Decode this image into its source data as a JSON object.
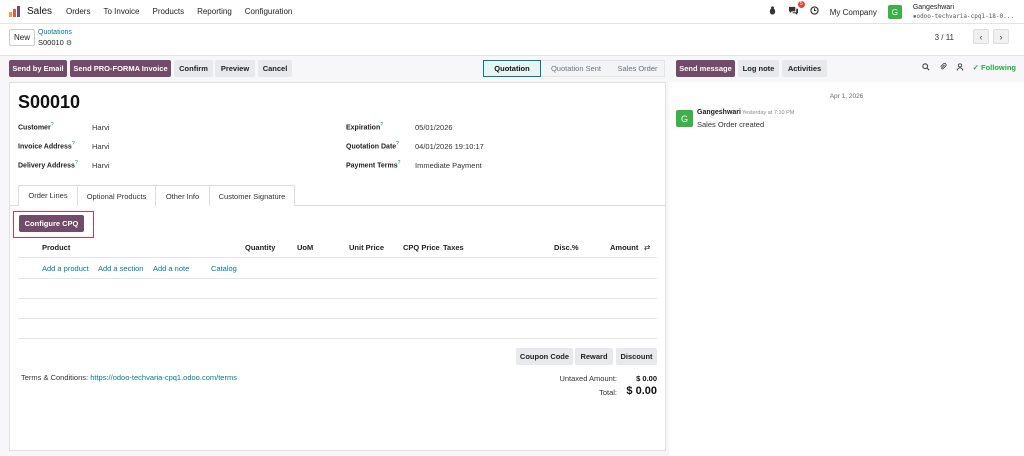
{
  "topnav": {
    "brand": "Sales",
    "menu": [
      "Orders",
      "To Invoice",
      "Products",
      "Reporting",
      "Configuration"
    ],
    "messages_badge": "5",
    "company": "My Company",
    "user_initial": "G",
    "user_name": "Gangeshwari",
    "user_db": "odoo-techvaria-cpq1-18-0..."
  },
  "control": {
    "new_label": "New",
    "breadcrumb_parent": "Quotations",
    "breadcrumb_current": "S00010",
    "pager": "3 / 11",
    "prev": "‹",
    "next": "›"
  },
  "actions": {
    "send_email": "Send by Email",
    "send_proforma": "Send PRO-FORMA Invoice",
    "confirm": "Confirm",
    "preview": "Preview",
    "cancel": "Cancel",
    "statuses": [
      "Quotation",
      "Quotation Sent",
      "Sales Order"
    ]
  },
  "chatter_actions": {
    "send_message": "Send message",
    "log_note": "Log note",
    "activities": "Activities",
    "following": "Following"
  },
  "form": {
    "name": "S00010",
    "customer_label": "Customer",
    "customer": "Harvi",
    "invoice_address_label": "Invoice Address",
    "invoice_address": "Harvi",
    "delivery_address_label": "Delivery Address",
    "delivery_address": "Harvi",
    "expiration_label": "Expiration",
    "expiration": "05/01/2026",
    "quotation_date_label": "Quotation Date",
    "quotation_date": "04/01/2026 19:10:17",
    "payment_terms_label": "Payment Terms",
    "payment_terms": "Immediate Payment",
    "help_mark": "?"
  },
  "tabs": [
    "Order Lines",
    "Optional Products",
    "Other Info",
    "Customer Signature"
  ],
  "order_lines": {
    "configure_cpq": "Configure CPQ",
    "columns": [
      "Product",
      "Quantity",
      "UoM",
      "Unit Price",
      "CPQ Price",
      "Taxes",
      "Disc.%",
      "Amount"
    ],
    "add_product": "Add a product",
    "add_section": "Add a section",
    "add_note": "Add a note",
    "catalog": "Catalog"
  },
  "bottom": {
    "coupon_code": "Coupon Code",
    "reward": "Reward",
    "discount": "Discount",
    "terms_prefix": "Terms & Conditions:",
    "terms_link": "https://odoo-techvaria-cpq1.odoo.com/terms",
    "untaxed_label": "Untaxed Amount:",
    "untaxed_value": "$ 0.00",
    "total_label": "Total:",
    "total_value": "$ 0.00"
  },
  "chatter": {
    "date": "Apr 1, 2026",
    "author_initial": "G",
    "author": "Gangeshwari",
    "time": "Yesterday at 7:10 PM",
    "body": "Sales Order created"
  },
  "colors": {
    "primary": "#714b67",
    "link": "#017e84",
    "highlight": "#dc3545",
    "avatar": "#3eb049"
  }
}
